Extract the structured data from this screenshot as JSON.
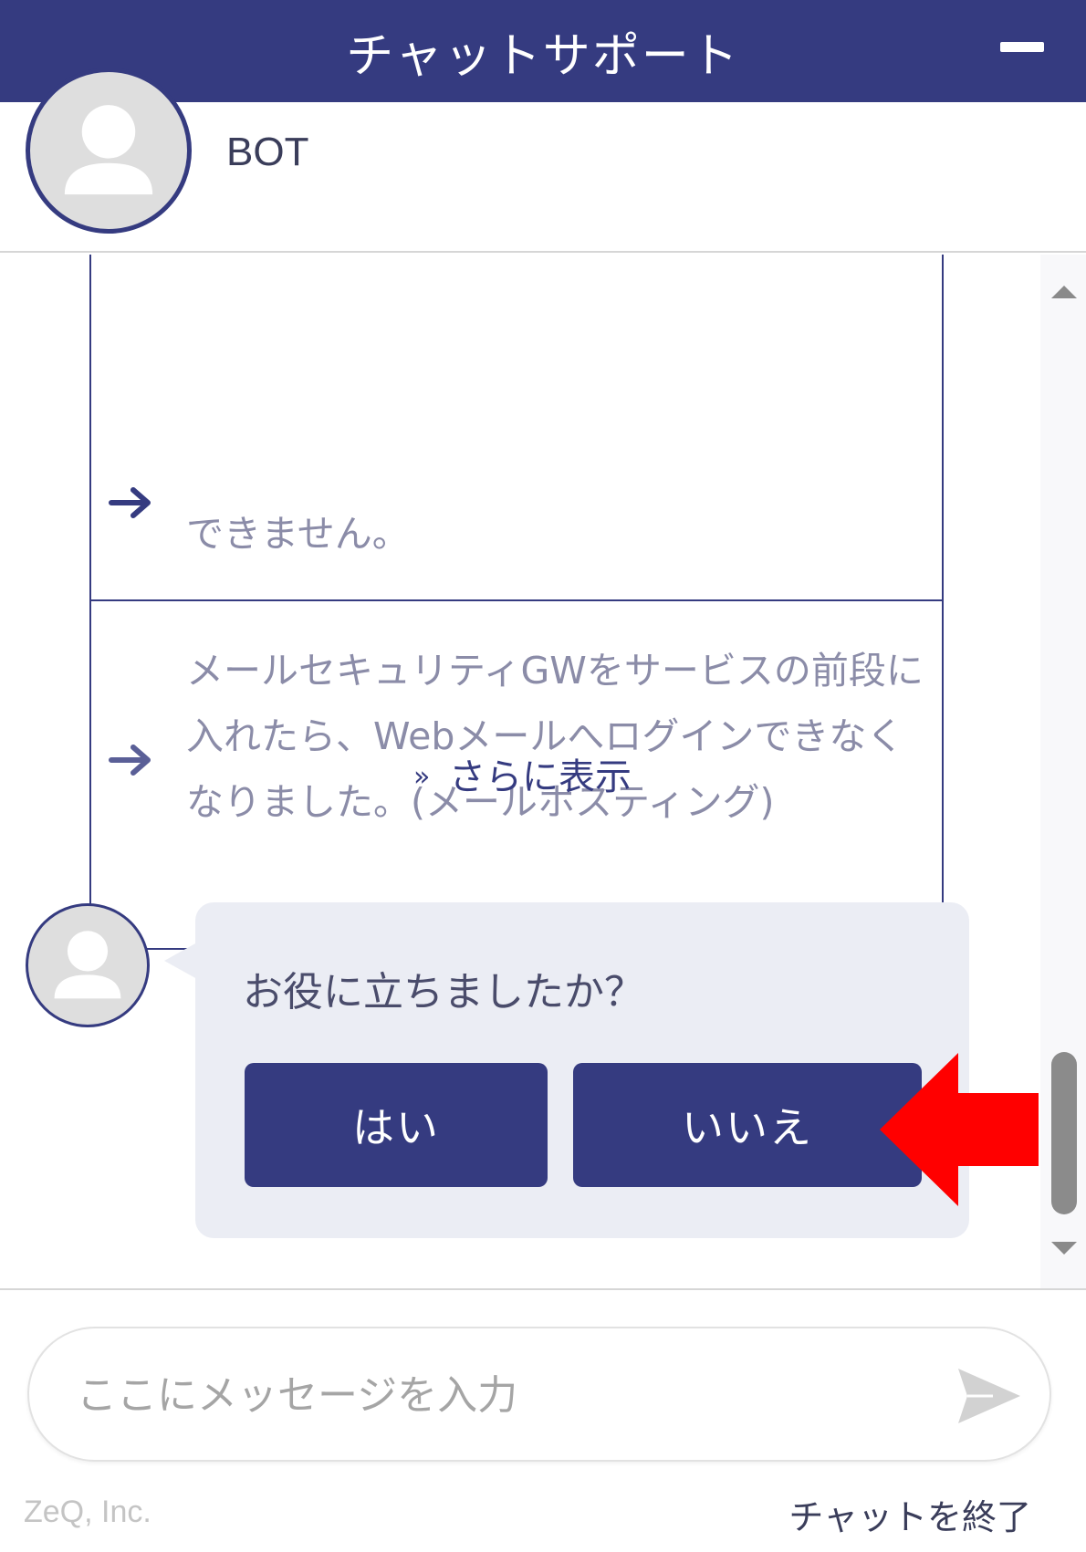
{
  "header": {
    "title": "チャットサポート"
  },
  "agent": {
    "name": "BOT"
  },
  "faq": {
    "items": [
      {
        "text": "できません。"
      },
      {
        "text": "メールセキュリティGWをサービスの前段に入れたら、Webメールへログインできなくなりました。(メールホスティング)"
      }
    ],
    "show_more_label": "さらに表示"
  },
  "feedback": {
    "question": "お役に立ちましたか？",
    "yes_label": "はい",
    "no_label": "いいえ"
  },
  "input": {
    "placeholder": "ここにメッセージを入力",
    "value": ""
  },
  "footer": {
    "copyright": "ZeQ, Inc.",
    "end_chat_label": "チャットを終了"
  },
  "colors": {
    "brand": "#353b80",
    "annotation": "#ff0000",
    "bubble": "#ebedf4"
  },
  "icons": {
    "avatar": "person-icon",
    "faq_arrow": "arrow-right-icon",
    "show_more": "chevron-double-down-icon",
    "send": "send-icon",
    "minimize": "minimize-icon",
    "annotation": "red-arrow-left-icon"
  }
}
